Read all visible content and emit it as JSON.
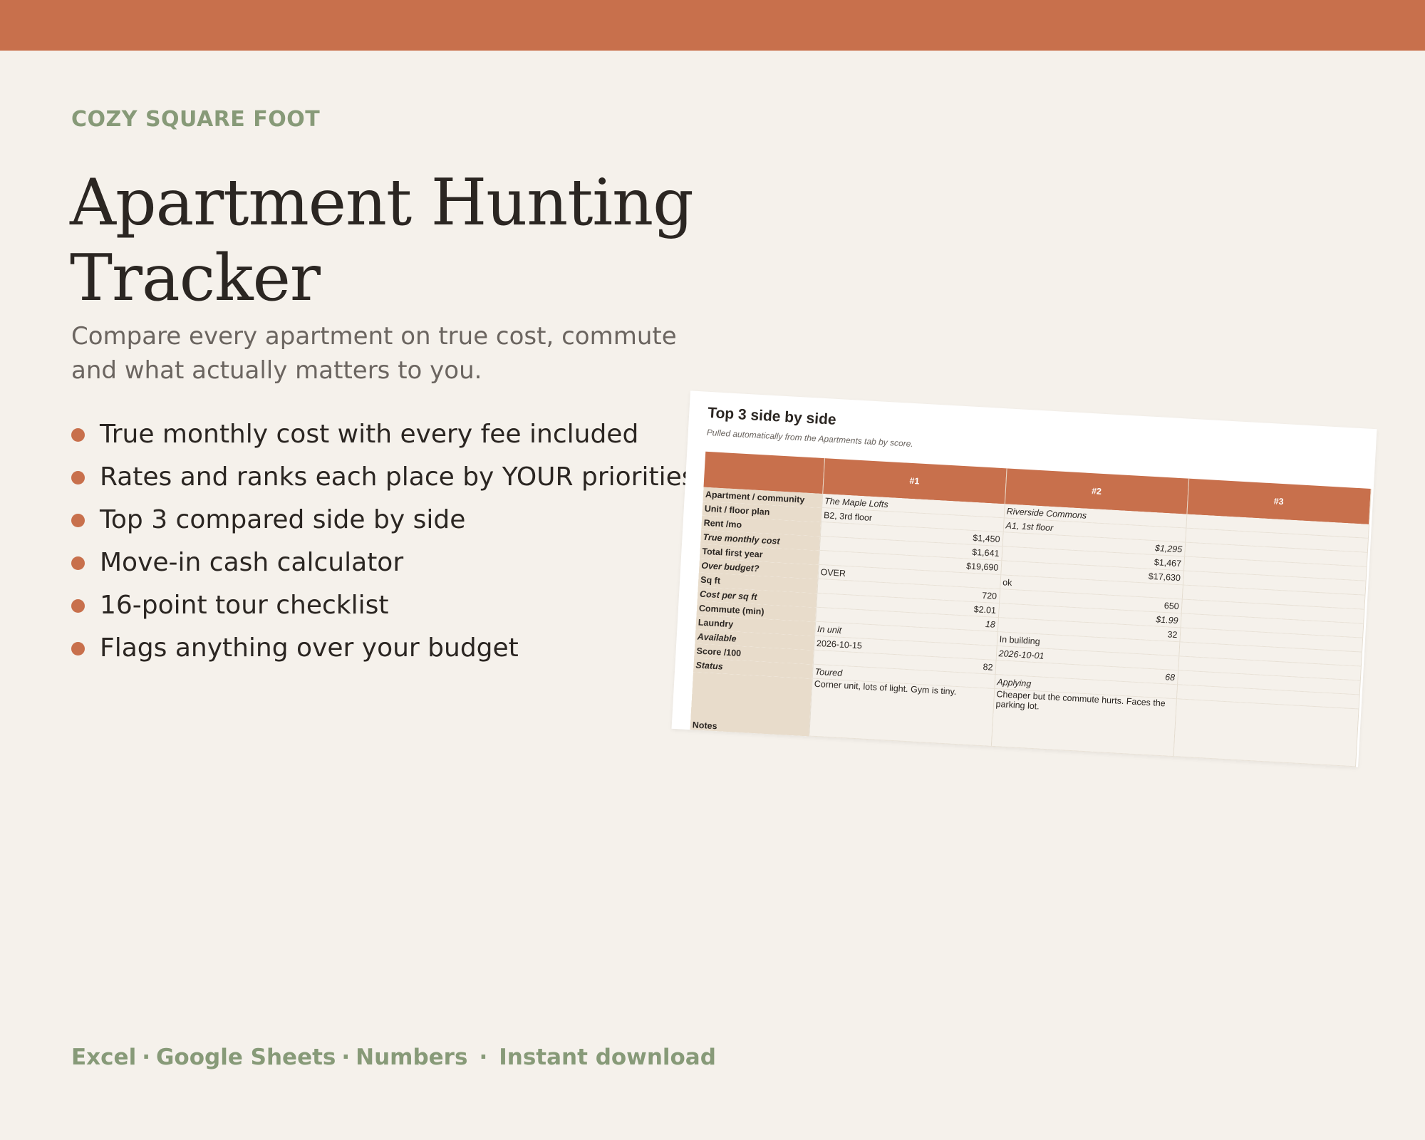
{
  "brand": "COZY SQUARE FOOT",
  "title_line1": "Apartment Hunting",
  "title_line2": "Tracker",
  "subtitle": "Compare every apartment on true cost, commute and what actually matters to you.",
  "features": [
    "True monthly cost with every fee included",
    "Rates and ranks each place by YOUR priorities",
    "Top 3 compared side by side",
    "Move-in cash calculator",
    "16-point tour checklist",
    "Flags anything over your budget"
  ],
  "footer": {
    "platforms": [
      "Excel",
      "Google Sheets",
      "Numbers"
    ],
    "separator": "·",
    "download": "Instant download"
  },
  "colors": {
    "accent": "#c8704c",
    "sage": "#879a78",
    "background": "#f5f1eb",
    "label_column": "#e8dccb"
  },
  "sheet": {
    "title": "Top 3 side by side",
    "note": "Pulled automatically from the Apartments tab by score.",
    "headers": [
      "",
      "#1",
      "#2",
      "#3"
    ],
    "rows": [
      {
        "label": "Apartment / community",
        "v1": "The Maple Lofts",
        "v2": "Riverside Commons",
        "v3": ""
      },
      {
        "label": "Unit / floor plan",
        "v1": "B2, 3rd floor",
        "v2": "A1, 1st floor",
        "v3": ""
      },
      {
        "label": "Rent /mo",
        "v1": "$1,450",
        "v2": "$1,295",
        "v3": ""
      },
      {
        "label": "True monthly cost",
        "v1": "$1,641",
        "v2": "$1,467",
        "v3": ""
      },
      {
        "label": "Total first year",
        "v1": "$19,690",
        "v2": "$17,630",
        "v3": ""
      },
      {
        "label": "Over budget?",
        "v1": "OVER",
        "v2": "ok",
        "v3": ""
      },
      {
        "label": "Sq ft",
        "v1": "720",
        "v2": "650",
        "v3": ""
      },
      {
        "label": "Cost per sq ft",
        "v1": "$2.01",
        "v2": "$1.99",
        "v3": ""
      },
      {
        "label": "Commute (min)",
        "v1": "18",
        "v2": "32",
        "v3": ""
      },
      {
        "label": "Laundry",
        "v1": "In unit",
        "v2": "In building",
        "v3": ""
      },
      {
        "label": "Available",
        "v1": "2026-10-15",
        "v2": "2026-10-01",
        "v3": ""
      },
      {
        "label": "Score /100",
        "v1": "82",
        "v2": "68",
        "v3": ""
      },
      {
        "label": "Status",
        "v1": "Toured",
        "v2": "Applying",
        "v3": ""
      },
      {
        "label": "Notes",
        "v1": "Corner unit, lots of light. Gym is tiny.",
        "v2": "Cheaper but the commute hurts. Faces the parking lot.",
        "v3": ""
      }
    ]
  }
}
